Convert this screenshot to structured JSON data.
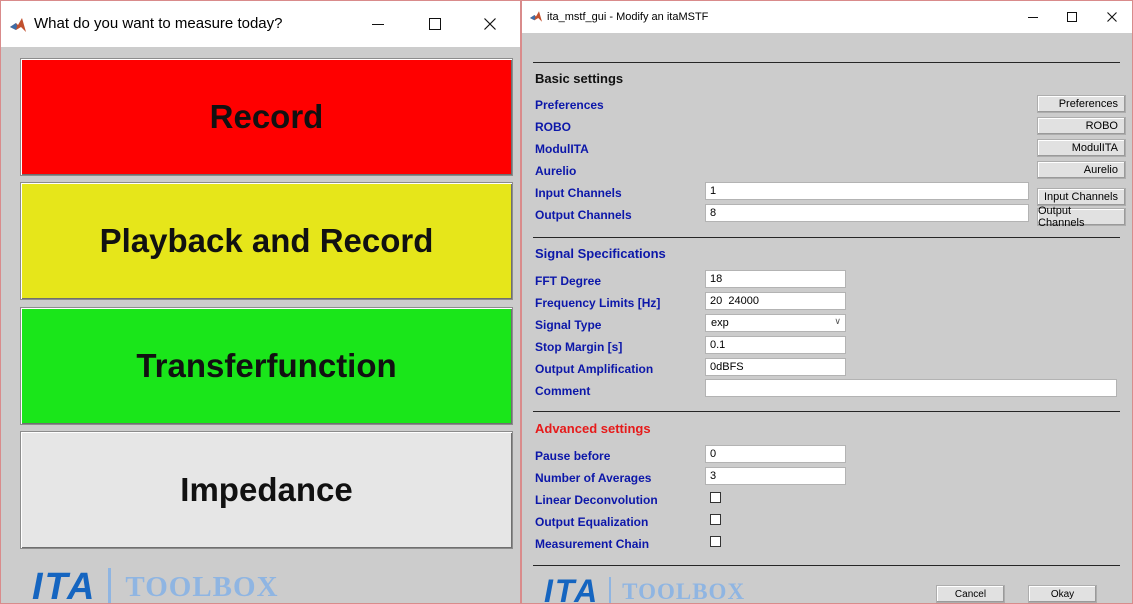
{
  "launcher": {
    "title": "What do you want to measure today?",
    "buttons": [
      {
        "label": "Record",
        "color": "#ff0000"
      },
      {
        "label": "Playback and Record",
        "color": "#e6e61a"
      },
      {
        "label": "Transferfunction",
        "color": "#1ae61a"
      },
      {
        "label": "Impedance",
        "color": "#e6e6e6"
      }
    ],
    "logo": {
      "ita": "ITA",
      "toolbox": "TOOLBOX"
    }
  },
  "mstf": {
    "title": "ita_mstf_gui - Modify an itaMSTF",
    "basic": {
      "heading": "Basic settings",
      "preferences_label": "Preferences",
      "robo_label": "ROBO",
      "modulita_label": "ModulITA",
      "aurelio_label": "Aurelio",
      "input_channels_label": "Input Channels",
      "input_channels_value": "1",
      "output_channels_label": "Output Channels",
      "output_channels_value": "8",
      "buttons": {
        "preferences": "Preferences",
        "robo": "ROBO",
        "modulita": "ModulITA",
        "aurelio": "Aurelio",
        "input_channels": "Input Channels",
        "output_channels": "Output Channels"
      }
    },
    "signal": {
      "heading": "Signal Specifications",
      "fft_degree_label": "FFT Degree",
      "fft_degree_value": "18",
      "freq_limits_label": "Frequency Limits [Hz]",
      "freq_limits_value": "20  24000",
      "signal_type_label": "Signal Type",
      "signal_type_value": "exp",
      "stop_margin_label": "Stop Margin [s]",
      "stop_margin_value": "0.1",
      "output_amp_label": "Output Amplification",
      "output_amp_value": "0dBFS",
      "comment_label": "Comment",
      "comment_value": ""
    },
    "advanced": {
      "heading": "Advanced settings",
      "pause_before_label": "Pause before",
      "pause_before_value": "0",
      "averages_label": "Number of Averages",
      "averages_value": "3",
      "linear_deconv_label": "Linear Deconvolution",
      "output_eq_label": "Output Equalization",
      "meas_chain_label": "Measurement Chain",
      "linear_deconv_checked": false,
      "output_eq_checked": false,
      "meas_chain_checked": false
    },
    "footer": {
      "cancel": "Cancel",
      "okay": "Okay"
    },
    "logo": {
      "ita": "ITA",
      "toolbox": "TOOLBOX"
    }
  },
  "colors": {
    "label_blue": "#0c17a9",
    "advanced_red": "#e61a1a",
    "logo_blue": "#1565c0",
    "logo_light_blue": "#8fb5e2",
    "panel_gray": "#cccccc"
  },
  "icons": {
    "app": "matlab-icon",
    "minimize": "minimize-icon",
    "maximize": "maximize-icon",
    "close": "close-icon"
  }
}
